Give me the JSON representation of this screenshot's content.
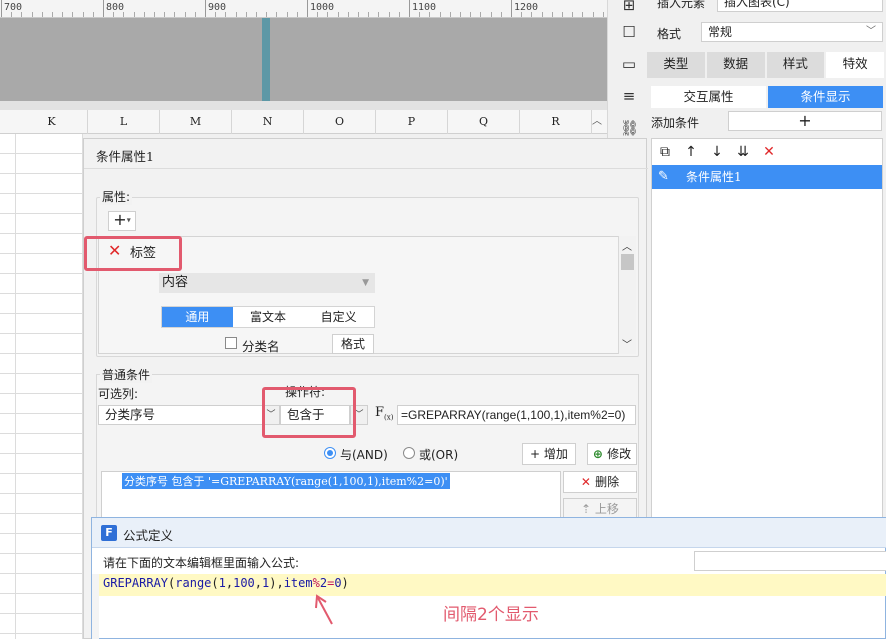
{
  "ruler": {
    "labels": [
      "700",
      "800",
      "900",
      "1000",
      "1100",
      "1200"
    ]
  },
  "sheet": {
    "columns": [
      "K",
      "L",
      "M",
      "N",
      "O",
      "P",
      "Q",
      "R"
    ]
  },
  "right_panel": {
    "insert_element": "插入元素",
    "insert_chart": "插入图表(C)",
    "format_label": "格式",
    "format_value": "常规",
    "tabs": [
      "类型",
      "数据",
      "样式",
      "特效"
    ],
    "subtabs": [
      "交互属性",
      "条件显示"
    ],
    "add_condition_label": "添加条件",
    "add_condition_button": "+",
    "condition_item": "条件属性1"
  },
  "dialog": {
    "title": "条件属性1",
    "property_group_label": "属性:",
    "tag_label": "标签",
    "content_select": "内容",
    "content_tabs": [
      "通用",
      "富文本",
      "自定义"
    ],
    "category_name_label": "分类名",
    "style_button": "格式",
    "normal_condition_label": "普通条件",
    "optional_label": "可选列:",
    "operator_label": "操作符:",
    "optional_value": "分类序号",
    "operator_value": "包含于",
    "fx_label": "F",
    "fx_sub": "(x)",
    "formula_value": "=GREPARRAY(range(1,100,1),item%2=0)",
    "and_label": "与(AND)",
    "or_label": "或(OR)",
    "add_button": "增加",
    "modify_button": "修改",
    "condition_text": "分类序号 包含于 '=GREPARRAY(range(1,100,1),item%2=0)'",
    "delete_button": "删除",
    "move_up_button": "上移"
  },
  "formula_dialog": {
    "title": "公式定义",
    "hint": "请在下面的文本编辑框里面输入公式:",
    "code_tokens": [
      {
        "t": "GREPARRAY",
        "c": "c-fn"
      },
      {
        "t": "(",
        "c": ""
      },
      {
        "t": "range",
        "c": "c-fn"
      },
      {
        "t": "(",
        "c": ""
      },
      {
        "t": "1",
        "c": "c-num"
      },
      {
        "t": ",",
        "c": ""
      },
      {
        "t": "100",
        "c": "c-num"
      },
      {
        "t": ",",
        "c": ""
      },
      {
        "t": "1",
        "c": "c-num"
      },
      {
        "t": "),",
        "c": ""
      },
      {
        "t": "item",
        "c": "c-id"
      },
      {
        "t": "%",
        "c": "c-op"
      },
      {
        "t": "2",
        "c": "c-num"
      },
      {
        "t": "=",
        "c": "c-op"
      },
      {
        "t": "0",
        "c": "c-num"
      },
      {
        "t": ")",
        "c": ""
      }
    ]
  },
  "annotation": {
    "note": "间隔2个显示",
    "color": "#e25a6e"
  },
  "colors": {
    "accent": "#3d8ff4",
    "delete_red": "#e0282a"
  }
}
